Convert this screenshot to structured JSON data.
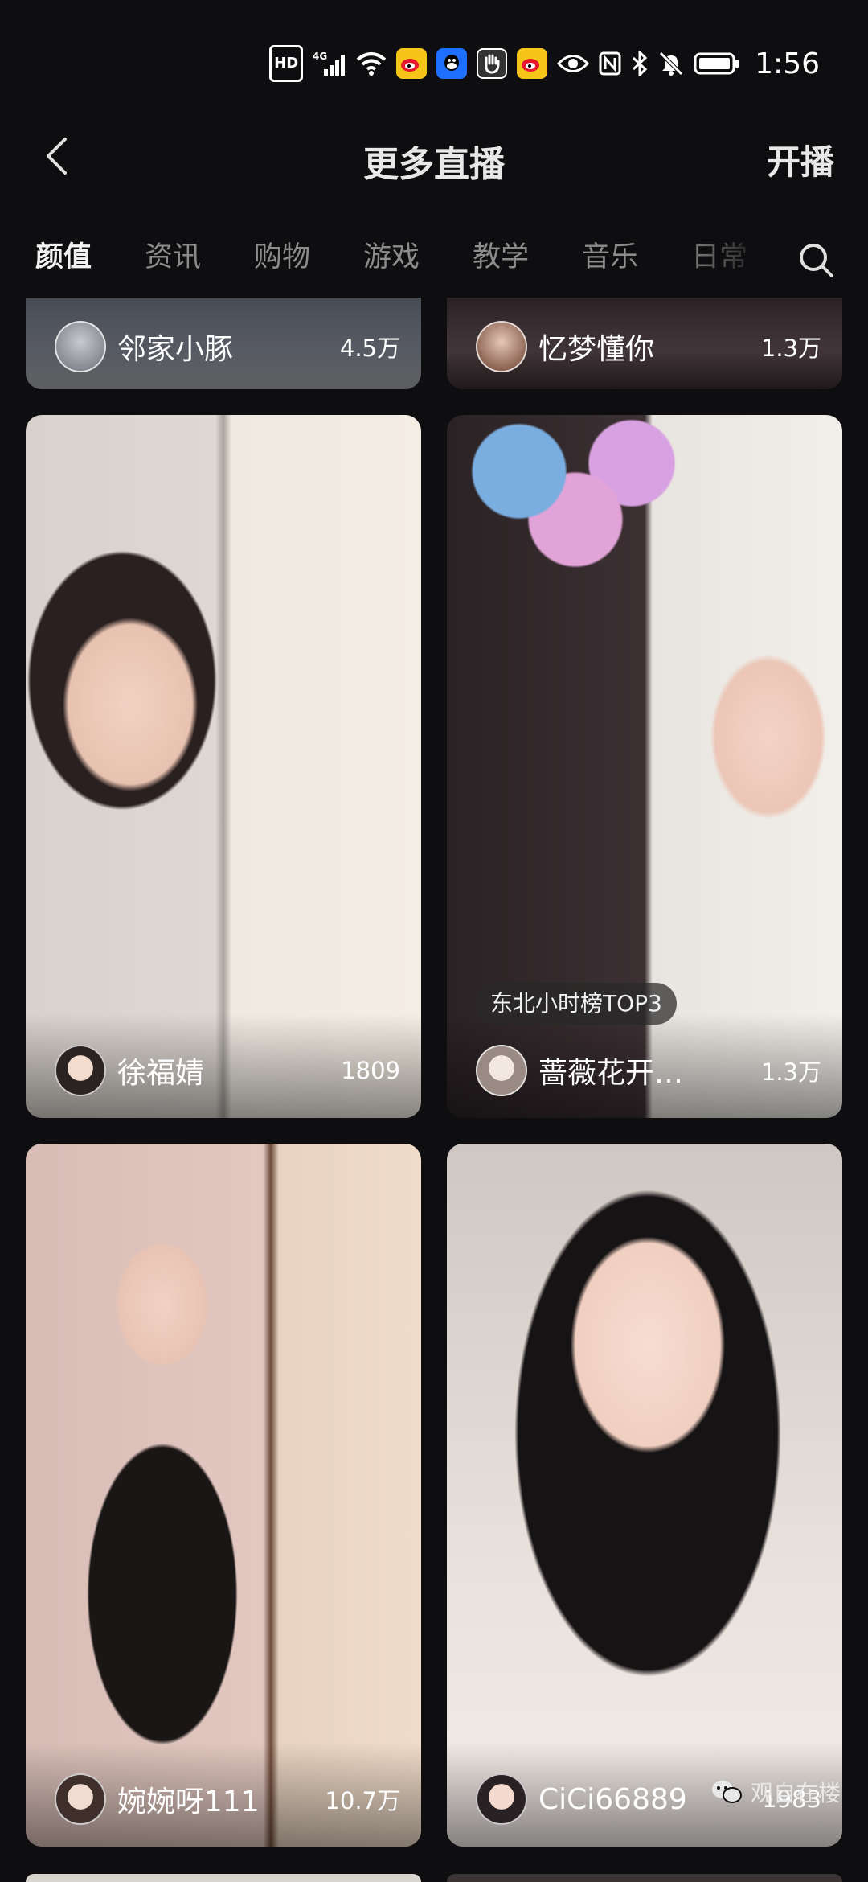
{
  "status_bar": {
    "hd": "HD",
    "network": "4G",
    "time": "1:56",
    "icons": [
      "hd-badge",
      "signal-4g-icon",
      "wifi-icon",
      "weibo-icon",
      "qq-icon",
      "hand-icon",
      "weibo-icon",
      "eye-icon",
      "nfc-icon",
      "bluetooth-icon",
      "mute-bell-icon",
      "battery-icon"
    ]
  },
  "nav": {
    "title": "更多直播",
    "action": "开播"
  },
  "tabs": [
    {
      "label": "颜值",
      "active": true
    },
    {
      "label": "资讯",
      "active": false
    },
    {
      "label": "购物",
      "active": false
    },
    {
      "label": "游戏",
      "active": false
    },
    {
      "label": "教学",
      "active": false
    },
    {
      "label": "音乐",
      "active": false
    },
    {
      "label": "日常",
      "active": false
    }
  ],
  "cards": [
    {
      "name": "邻家小豚",
      "viewers": "4.5万"
    },
    {
      "name": "忆梦懂你",
      "viewers": "1.3万"
    },
    {
      "name": "徐福婧",
      "viewers": "1809"
    },
    {
      "name": "蔷薇花开…",
      "viewers": "1.3万",
      "badge": "东北小时榜TOP3"
    },
    {
      "name": "婉婉呀111",
      "viewers": "10.7万"
    },
    {
      "name": "CiCi66889",
      "viewers": "1983"
    }
  ],
  "watermark": {
    "text": "观自在楼"
  },
  "colors": {
    "background": "#0e0e10",
    "active_tab": "#f2f2f2",
    "inactive_tab": "#8c8c8c"
  }
}
